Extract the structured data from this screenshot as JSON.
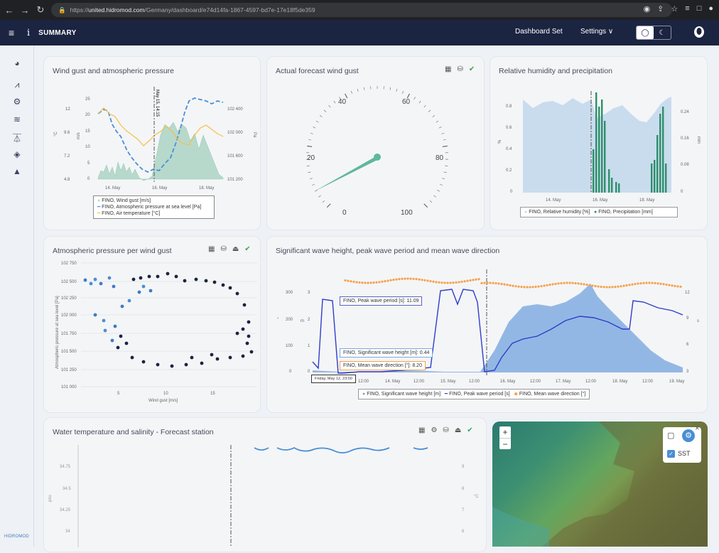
{
  "browser": {
    "url_prefix": "https://",
    "url_host": "united.hidromod.com",
    "url_path": "/Germany/dashboard/e74d14fa-1867-4597-bd7e-17e18f5de359"
  },
  "header": {
    "title": "SUMMARY",
    "dashboard_set": "Dashboard Set",
    "settings": "Settings ∨"
  },
  "sidebar": {
    "logo": "HIDROMOD",
    "icons": [
      "globe-icon",
      "chart-area-icon",
      "gears-icon",
      "waves-icon",
      "buoy-icon",
      "layers-icon",
      "mountain-icon"
    ]
  },
  "colors": {
    "accent": "#1b2440",
    "wind_fill": "#b7d9cc",
    "pressure": "#4a8fd4",
    "temp": "#f5c04a",
    "wave_fill": "#7aa8de",
    "peak": "#2f3cc9",
    "dir": "#f5a14a",
    "green": "#2f8f6a"
  },
  "cards": {
    "wind_pressure": {
      "title": "Wind gust and atmospheric pressure",
      "y1_ticks": [
        "25",
        "20",
        "15",
        "10",
        "5",
        "0"
      ],
      "y2_ticks": [
        "102 400",
        "102 000",
        "101 600",
        "101 200"
      ],
      "y3_ticks": [
        "12",
        "9.6",
        "7.2",
        "4.8"
      ],
      "y1_unit": "m/s",
      "y3_unit": "°C",
      "y2_unit": "Pa",
      "x_ticks": [
        "14. May",
        "16. May",
        "18. May"
      ],
      "marker": "May 15, 14:15",
      "legend": [
        "FINO, Wind gust [m/s]",
        "FINO, Atmospheric pressure at sea level [Pa]",
        "FINO, Air temperature [°C]"
      ]
    },
    "gauge": {
      "title": "Actual forecast wind gust",
      "ticks": [
        "0",
        "20",
        "40",
        "60",
        "80",
        "100"
      ]
    },
    "humidity": {
      "title": "Relative humidity and precipitation",
      "y1_ticks": [
        "0.8",
        "0.6",
        "0.4",
        "0.2",
        "0"
      ],
      "y2_ticks": [
        "0.24",
        "0.16",
        "0.08",
        "0"
      ],
      "y1_unit": "%",
      "y2_unit": "mm",
      "x_ticks": [
        "14. May",
        "16. May",
        "18. May"
      ],
      "legend": [
        "FINO, Relative humidity [%]",
        "FINO, Precipitation [mm]"
      ]
    },
    "scatter": {
      "title": "Atmospheric pressure per wind gust",
      "y_ticks": [
        "102 750",
        "102 500",
        "102 250",
        "102 000",
        "101 750",
        "101 500",
        "101 250",
        "101 000"
      ],
      "x_ticks": [
        "5",
        "10",
        "15"
      ],
      "ylabel": "Atmospheric pressure at sea level [Pa]",
      "xlabel": "Wind gust [m/s]"
    },
    "waves": {
      "title": "Significant wave height, peak wave period and mean wave direction",
      "y_dir_ticks": [
        "300",
        "200",
        "100",
        "0"
      ],
      "y_h_ticks": [
        "3",
        "2",
        "1",
        "0"
      ],
      "y_p_ticks": [
        "12",
        "9",
        "6",
        "3"
      ],
      "y_dir_unit": "°",
      "y_h_unit": "m",
      "y_p_unit": "s",
      "x_ticks": [
        "12:00",
        "14. May",
        "12:00",
        "15. May",
        "12:00",
        "16. May",
        "12:00",
        "17. May",
        "12:00",
        "18. May",
        "12:00",
        "19. May"
      ],
      "tooltips": [
        "FINO, Peak wave period [s]: 11.09",
        "FINO, Significant wave height [m]: 0.44",
        "FINO, Mean wave direction [°]: 8.20"
      ],
      "time_tip": "Friday, May 12, 23:00",
      "legend": [
        "FINO, Significant wave height [m]",
        "FINO, Peak wave period [s]",
        "FINO, Mean wave direction [°]"
      ]
    },
    "water": {
      "title": "Water temperature and salinity - Forecast station",
      "y1_ticks": [
        "34.75",
        "34.5",
        "34.25",
        "34"
      ],
      "y2_ticks": [
        "9",
        "8",
        "7",
        "6"
      ],
      "y1_unit": "psu",
      "y2_unit": "°C"
    },
    "map": {
      "layer": "SST",
      "zoom_in": "+",
      "zoom_out": "−"
    }
  }
}
